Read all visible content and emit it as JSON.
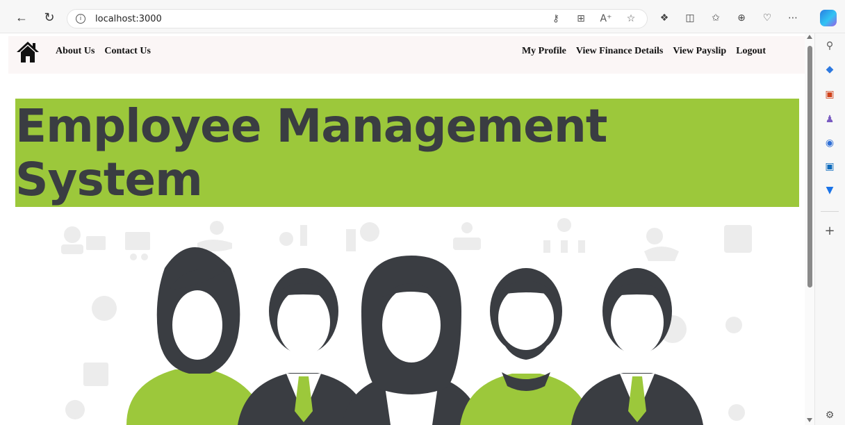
{
  "browser": {
    "url": "localhost:3000",
    "url_icon": "info-icon",
    "address_icons": [
      "key-icon",
      "app-grid-icon",
      "read-aloud-icon",
      "favorite-star-icon"
    ],
    "toolbar_icons": [
      "extensions-icon",
      "split-screen-icon",
      "favorites-icon",
      "collections-icon",
      "performance-icon",
      "more-icon"
    ],
    "toolbar_icon_labels": [
      "⚙",
      "◫",
      "☆",
      "⊕",
      "♡",
      "⋯"
    ],
    "address_icon_labels": [
      "⚿",
      "⊞",
      "A",
      "☆"
    ],
    "sidebar_icons": [
      "search-icon",
      "shopping-tag-icon",
      "tools-icon",
      "games-icon",
      "microsoft365-icon",
      "outlook-icon",
      "drop-icon",
      "add-icon",
      "settings-icon"
    ]
  },
  "site": {
    "nav_left": [
      "About Us",
      "Contact Us"
    ],
    "nav_right": [
      "My Profile",
      "View Finance Details",
      "View Payslip",
      "Logout"
    ],
    "banner_title": "Employee Management System",
    "accent_color": "#9cc83b",
    "dark_color": "#3a3d42"
  }
}
